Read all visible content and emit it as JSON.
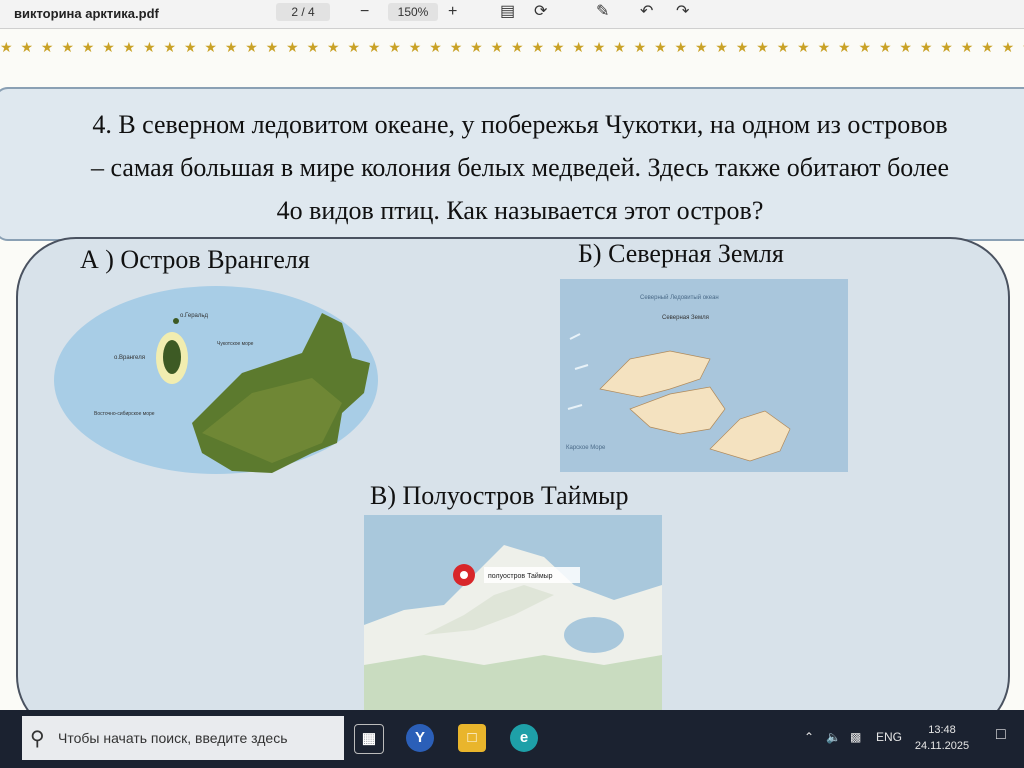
{
  "window": {
    "filename": "викторина арктика.pdf",
    "page_indicator": "2 / 4",
    "zoom_out": "−",
    "zoom": "150%",
    "zoom_in": "+"
  },
  "question": {
    "line1": "4. В северном ледовитом океане, у побережья Чукотки, на одном из островов",
    "line2": "– самая большая в мире колония белых медведей. Здесь также обитают более",
    "line3": "4о видов птиц. Как называется этот остров?"
  },
  "options": {
    "a": {
      "label": "А ) Остров Врангеля",
      "map_labels": [
        "о.Геральд",
        "о.Врангеля",
        "Чукотское море",
        "Восточно-сибирское море"
      ]
    },
    "b": {
      "label": "Б) Северная Земля",
      "map_labels": [
        "Северный Ледовитый океан",
        "Северная Земля",
        "Карское Море"
      ]
    },
    "c": {
      "label": "В) Полуостров Таймыр",
      "map_labels": [
        "полуостров Таймыр"
      ]
    }
  },
  "colors": {
    "accent": "#c9a227",
    "question_box": "#dfe8ef",
    "panel": "#d8e2ea",
    "pin": "#d8262a"
  },
  "taskbar": {
    "search_placeholder": "Чтобы начать поиск, введите здесь",
    "language": "ENG",
    "time": "13:48",
    "date": "24.11.2025",
    "apps": [
      "task-view-icon",
      "yandex-browser-icon",
      "file-explorer-icon",
      "edge-browser-icon"
    ]
  }
}
